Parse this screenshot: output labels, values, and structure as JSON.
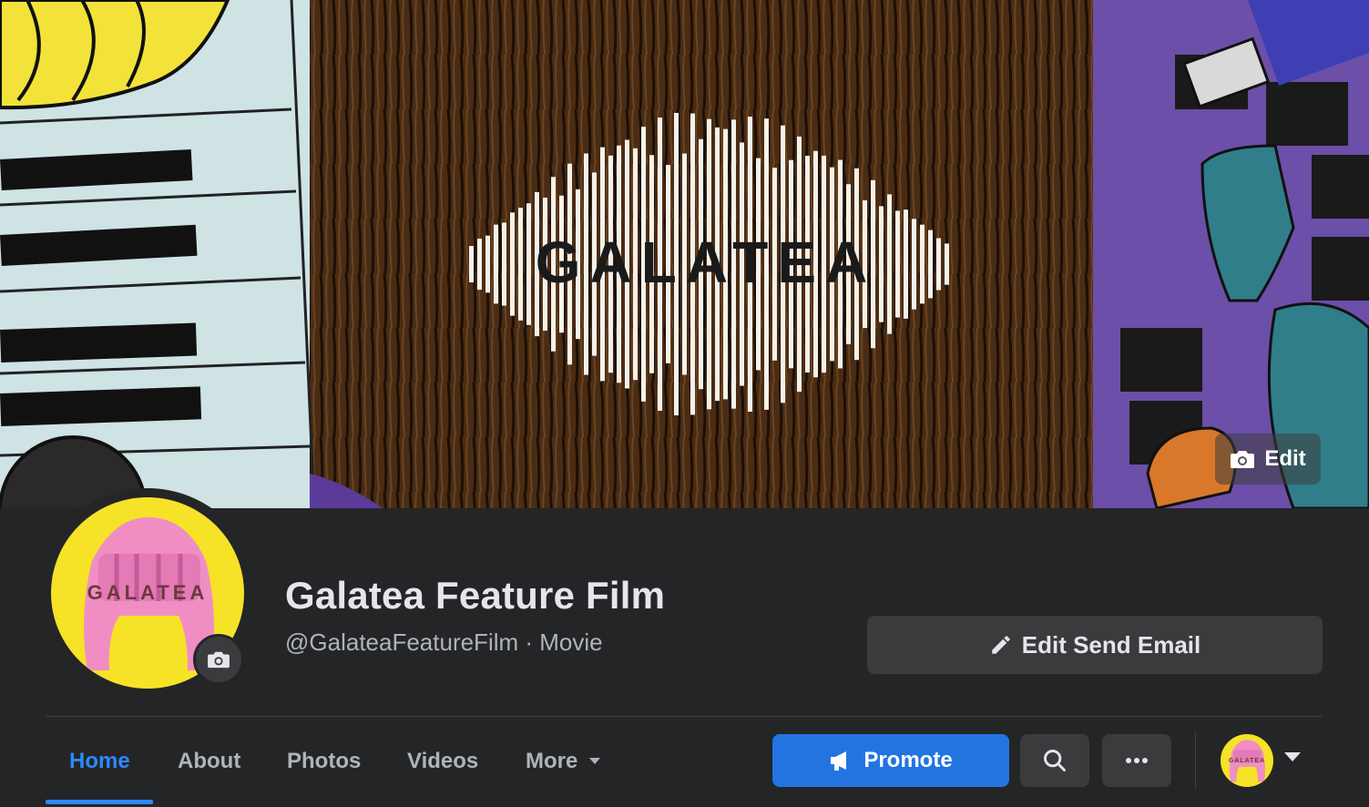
{
  "cover": {
    "logo_text": "GALATEA",
    "edit_label": "Edit",
    "camera_icon": "camera-icon"
  },
  "profile": {
    "avatar_text": "GALATEA",
    "name": "Galatea Feature Film",
    "subtitle": "@GalateaFeatureFilm · Movie",
    "edit_send_email_label": "Edit Send Email"
  },
  "tabs": [
    {
      "label": "Home",
      "active": true
    },
    {
      "label": "About"
    },
    {
      "label": "Photos"
    },
    {
      "label": "Videos"
    },
    {
      "label": "More"
    }
  ],
  "actions": {
    "promote_label": "Promote",
    "search_icon": "search-icon",
    "more_icon": "ellipsis-icon",
    "mini_avatar_text": "GALATEA"
  },
  "colors": {
    "background": "#242526",
    "accent": "#2d88ff",
    "promote": "#2374e1",
    "avatar_yellow": "#f6e227"
  }
}
